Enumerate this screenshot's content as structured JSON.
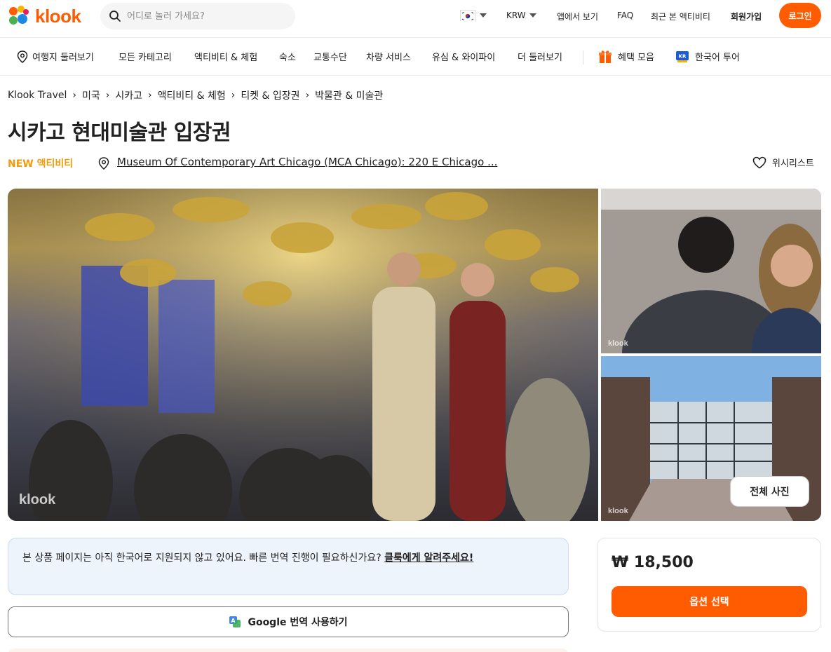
{
  "brand": {
    "name": "klook",
    "accent": "#ff5b00"
  },
  "search": {
    "placeholder": "어디로 놀러 가세요?"
  },
  "header": {
    "currency": "KRW",
    "app_link": "앱에서 보기",
    "faq": "FAQ",
    "recent": "최근 본 액티비티",
    "signup": "회원가입",
    "login": "로그인"
  },
  "nav": {
    "items": [
      "여행지 둘러보기",
      "모든 카테고리",
      "액티비티 & 체험",
      "숙소",
      "교통수단",
      "차량 서비스",
      "유심 & 와이파이",
      "더 둘러보기"
    ],
    "benefits": "혜택 모음",
    "korean_tour": "한국어 투어"
  },
  "breadcrumb": [
    "Klook Travel",
    "미국",
    "시카고",
    "액티비티 & 체험",
    "티켓 & 입장권",
    "박물관 & 미술관"
  ],
  "product": {
    "title": "시카고 현대미술관 입장권",
    "badge": "NEW 액티비티",
    "location": "Museum Of Contemporary Art Chicago (MCA Chicago): 220 E Chicago ...",
    "wishlist": "위시리스트"
  },
  "gallery": {
    "watermark": "klook",
    "all_photos": "전체 사진"
  },
  "notice": {
    "text": "본 상품 페이지는 아직 한국어로 지원되지 않고 있어요. 빠른 번역 진행이 필요하신가요? ",
    "link": "클룩에게 알려주세요!"
  },
  "google_translate": {
    "label": "Google 번역 사용하기"
  },
  "price_card": {
    "price": "₩ 18,500",
    "button": "옵션 선택"
  }
}
